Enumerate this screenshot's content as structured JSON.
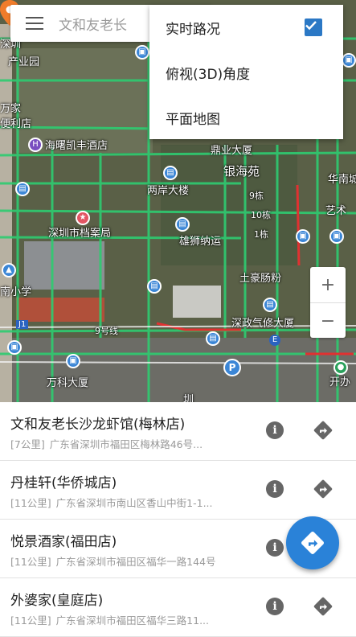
{
  "search": {
    "text": "文和友老长"
  },
  "layers_menu": {
    "items": [
      {
        "label": "实时路况",
        "checked": true
      },
      {
        "label": "俯视(3D)角度",
        "checked": false
      },
      {
        "label": "平面地图",
        "checked": false
      }
    ]
  },
  "map": {
    "labels": {
      "l1": "深圳",
      "l2": "产业园",
      "l3": "万家",
      "l4": "便利店",
      "l5": "海曙凯丰酒店",
      "l6": "两岸大楼",
      "l7": "深圳市档案局",
      "l8": "雄狮纳运",
      "l9": "9栋",
      "l10": "10栋",
      "l11": "1栋",
      "l12": "土豪肠粉",
      "l13": "深政气修大厦",
      "l14": "南小学",
      "l15": "9号线",
      "l16": "J1",
      "l17": "万科大厦",
      "l18": "圳",
      "l19": "华南城",
      "l20": "艺术",
      "l21": "开办",
      "l22": "鼎业大厦",
      "l23": "银海苑",
      "l24": "E"
    },
    "zoom_in": "+",
    "zoom_out": "−"
  },
  "places": [
    {
      "name": "文和友老长沙龙虾馆(梅林店)",
      "distance": "[7公里]",
      "address": "广东省深圳市福田区梅林路46号..."
    },
    {
      "name": "丹桂轩(华侨城店)",
      "distance": "[11公里]",
      "address": "广东省深圳市南山区香山中街1-1..."
    },
    {
      "name": "悦景酒家(福田店)",
      "distance": "[11公里]",
      "address": "广东省深圳市福田区福华一路144号"
    },
    {
      "name": "外婆家(皇庭店)",
      "distance": "[11公里]",
      "address": "广东省深圳市福田区福华三路11..."
    }
  ],
  "icons": {
    "menu": "hamburger-menu-icon",
    "check": "check-icon",
    "info": "info-icon",
    "route": "directions-icon",
    "fab": "navigation-icon",
    "pin": "location-pin-icon"
  },
  "colors": {
    "accent": "#2a82d8",
    "traffic_green": "#2ecc71",
    "traffic_red": "#e03131"
  }
}
